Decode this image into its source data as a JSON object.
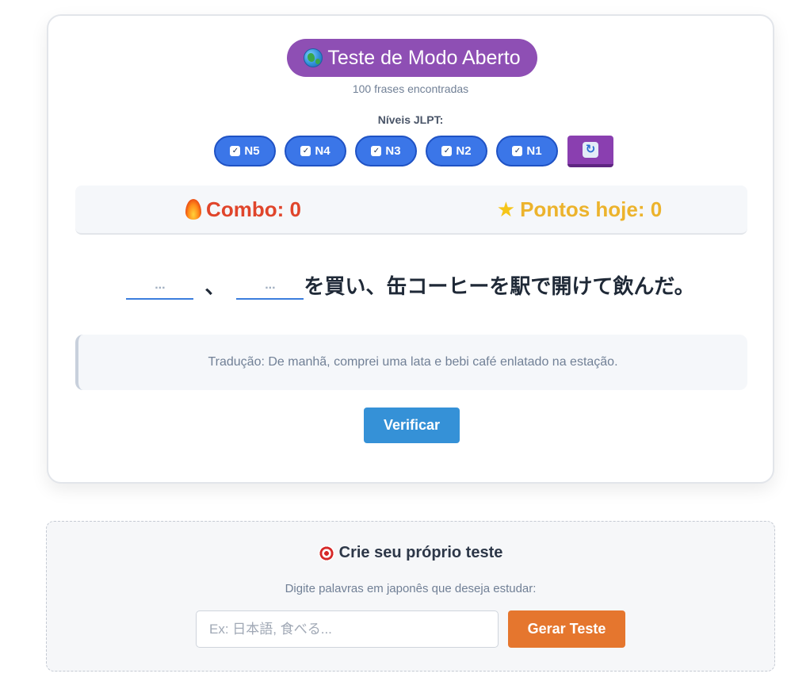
{
  "header": {
    "mode_title": "Teste de Modo Aberto",
    "mode_icon": "globe-icon",
    "found_text": "100 frases encontradas"
  },
  "levels": {
    "label": "Níveis JLPT:",
    "items": [
      {
        "label": "N5",
        "checked": true
      },
      {
        "label": "N4",
        "checked": true
      },
      {
        "label": "N3",
        "checked": true
      },
      {
        "label": "N2",
        "checked": true
      },
      {
        "label": "N1",
        "checked": true
      }
    ],
    "reset_icon": "refresh-icon"
  },
  "stats": {
    "combo_label": "Combo: 0",
    "points_label": "Pontos hoje: 0"
  },
  "question": {
    "blank_placeholder": "...",
    "separator": "、",
    "sentence_rest": "を買い、缶コーヒーを駅で開けて飲んだ。"
  },
  "translation": {
    "text": "Tradução: De manhã, comprei uma lata e bebi café enlatado na estação."
  },
  "actions": {
    "verify_label": "Verificar"
  },
  "create": {
    "title": "Crie seu próprio teste",
    "subtitle": "Digite palavras em japonês que deseja estudar:",
    "input_placeholder": "Ex: 日本語, 食べる...",
    "input_value": "",
    "generate_label": "Gerar Teste"
  },
  "colors": {
    "mode_badge": "#8e4fb4",
    "level_chip": "#3b76e8",
    "combo": "#e0452b",
    "points": "#ecb32c",
    "verify": "#3591d7",
    "generate": "#e5762e"
  }
}
